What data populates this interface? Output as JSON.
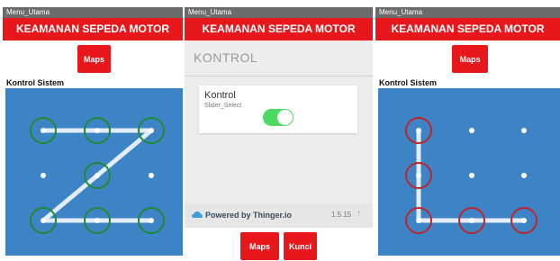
{
  "panel_left": {
    "status": "Menu_Utama",
    "title": "KEAMANAN SEPEDA MOTOR",
    "maps_label": "Maps",
    "section": "Kontrol Sistem",
    "pattern_color": "#1e8a34"
  },
  "panel_middle": {
    "status": "Menu_Utama",
    "title": "KEAMANAN SEPEDA MOTOR",
    "header": "KONTROL",
    "card_title": "Kontrol",
    "card_subtitle": "Slider_Select",
    "toggle_on": true,
    "powered_by": "Powered by Thinger.io",
    "version": "1.5.15",
    "maps_label": "Maps",
    "kunci_label": "Kunci",
    "toggle_color": "#4cd964"
  },
  "panel_right": {
    "status": "Menu_Utama",
    "title": "KEAMANAN SEPEDA MOTOR",
    "maps_label": "Maps",
    "section": "Kontrol Sistem",
    "pattern_color": "#c0242b"
  },
  "colors": {
    "title_bar": "#e8171b",
    "grid_bg": "#3d84c6",
    "status_bar": "#6b6b6b"
  }
}
